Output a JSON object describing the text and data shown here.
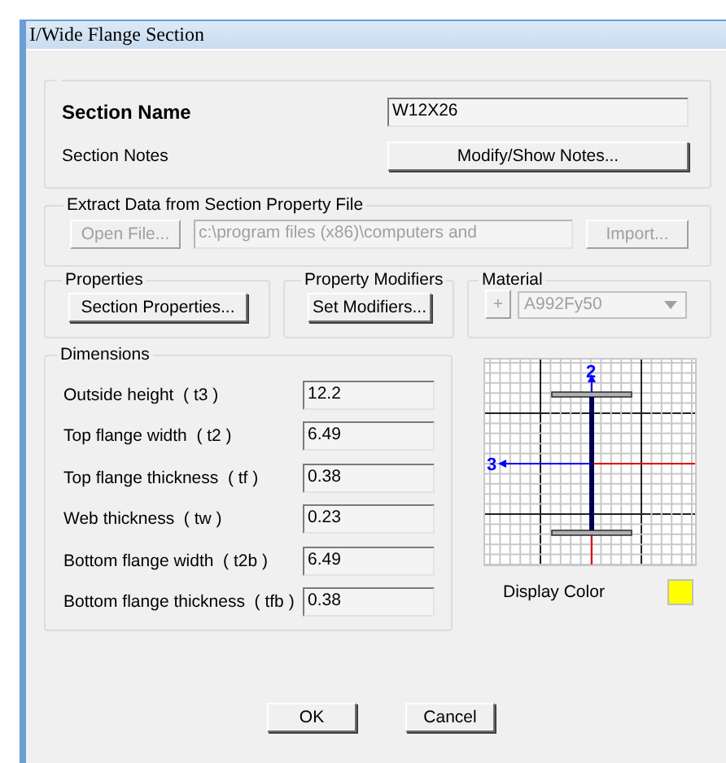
{
  "window": {
    "title": "I/Wide Flange Section"
  },
  "section": {
    "name_label": "Section Name",
    "name_value": "W12X26",
    "notes_label": "Section Notes",
    "notes_button": "Modify/Show Notes..."
  },
  "extract": {
    "legend": "Extract Data from Section Property File",
    "open_button": {
      "label": "Open File...",
      "disabled": true
    },
    "path": {
      "value": "c:\\program files (x86)\\computers and",
      "disabled": true
    },
    "import_button": {
      "label": "Import...",
      "disabled": true
    }
  },
  "properties": {
    "legend": "Properties",
    "button": "Section Properties..."
  },
  "modifiers": {
    "legend": "Property Modifiers",
    "button": "Set Modifiers..."
  },
  "material": {
    "legend": "Material",
    "add_button": {
      "label": "+",
      "disabled": true
    },
    "dropdown": {
      "value": "A992Fy50",
      "disabled": true
    }
  },
  "dimensions": {
    "legend": "Dimensions",
    "rows": [
      {
        "label": "Outside height  ( t3 )",
        "value": "12.2"
      },
      {
        "label": "Top flange width  ( t2 )",
        "value": "6.49"
      },
      {
        "label": "Top flange thickness  ( tf )",
        "value": "0.38"
      },
      {
        "label": "Web thickness  ( tw )",
        "value": "0.23"
      },
      {
        "label": "Bottom flange width  ( t2b )",
        "value": "6.49"
      },
      {
        "label": "Bottom flange thickness  ( tfb )",
        "value": "0.38"
      }
    ]
  },
  "preview": {
    "axis_labels": [
      "2",
      "3"
    ]
  },
  "display_color": {
    "label": "Display Color",
    "color": "#ffff00"
  },
  "buttons": [
    "OK",
    "Cancel"
  ]
}
